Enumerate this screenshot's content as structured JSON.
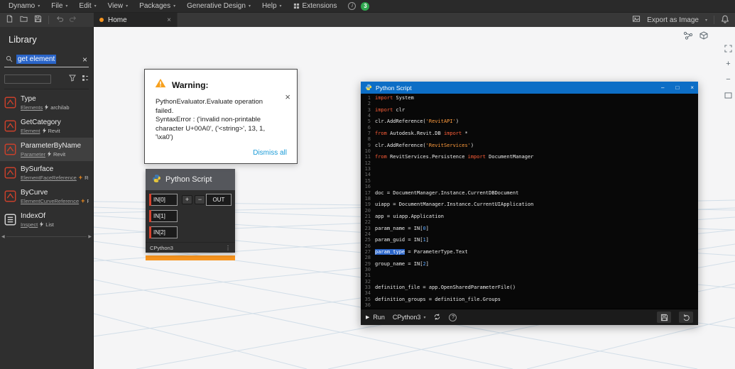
{
  "colors": {
    "accent_blue": "#1a9bd7",
    "titlebar_blue": "#0d6ec6",
    "warning_orange": "#f7a01d",
    "unsaved_orange": "#f7941e",
    "node_error_red": "#d9432e",
    "badge_green": "#2fa84f",
    "selection_blue": "#2a65c9",
    "token_keyword": "#ff5e38",
    "token_string": "#ff9b3d",
    "token_number": "#58a6ff"
  },
  "menubar": {
    "items": [
      {
        "label": "Dynamo",
        "caret": true
      },
      {
        "label": "File",
        "caret": true
      },
      {
        "label": "Edit",
        "caret": true
      },
      {
        "label": "View",
        "caret": true
      },
      {
        "label": "Packages",
        "caret": true
      },
      {
        "label": "Generative Design",
        "caret": true
      },
      {
        "label": "Help",
        "caret": true
      },
      {
        "label": "Extensions",
        "caret": false,
        "icon": "extensions-icon"
      }
    ],
    "notification_count": "3"
  },
  "tabbar": {
    "tab_label": "Home",
    "export_label": "Export as Image"
  },
  "library": {
    "title": "Library",
    "search_value": "get element",
    "items": [
      {
        "title": "Type",
        "category": "Elements",
        "source": "archilab",
        "kind": "action",
        "icon_color": "#c8402b",
        "icon_shape": "box",
        "selected": false
      },
      {
        "title": "GetCategory",
        "category": "Element",
        "source": "Revit",
        "kind": "action",
        "icon_color": "#c8402b",
        "icon_shape": "box",
        "selected": false
      },
      {
        "title": "ParameterByName",
        "category": "Parameter",
        "source": "Revit",
        "kind": "action",
        "icon_color": "#c8402b",
        "icon_shape": "box",
        "selected": true
      },
      {
        "title": "BySurface",
        "category": "ElementFaceReference",
        "source": "Revit",
        "kind": "create",
        "icon_color": "#c8402b",
        "icon_shape": "box",
        "selected": false
      },
      {
        "title": "ByCurve",
        "category": "ElementCurveReference",
        "source": "Revit",
        "kind": "create",
        "icon_color": "#c8402b",
        "icon_shape": "box",
        "selected": false
      },
      {
        "title": "IndexOf",
        "category": "Inspect",
        "source": "List",
        "kind": "action",
        "icon_color": "#d2d2d2",
        "icon_shape": "list",
        "selected": false
      }
    ]
  },
  "warning_popup": {
    "title": "Warning:",
    "message_lines": [
      "PythonEvaluator.Evaluate operation failed.",
      "SyntaxError : ('invalid non-printable",
      "character U+00A0', ('<string>', 13, 1,",
      "'\\xa0')"
    ],
    "dismiss_label": "Dismiss all"
  },
  "python_node": {
    "title": "Python Script",
    "inputs": [
      "IN[0]",
      "IN[1]",
      "IN[2]"
    ],
    "output_label": "OUT",
    "engine_label": "CPython3"
  },
  "editor": {
    "window_title": "Python Script",
    "run_label": "Run",
    "engine_label": "CPython3",
    "code": [
      {
        "n": 1,
        "seg": [
          [
            "k",
            "import"
          ],
          [
            "p",
            " System"
          ]
        ]
      },
      {
        "n": 2,
        "seg": []
      },
      {
        "n": 3,
        "seg": [
          [
            "k",
            "import"
          ],
          [
            "p",
            " clr"
          ]
        ]
      },
      {
        "n": 4,
        "seg": []
      },
      {
        "n": 5,
        "seg": [
          [
            "p",
            "clr.AddReference("
          ],
          [
            "s",
            "'RevitAPI'"
          ],
          [
            "p",
            ")"
          ]
        ]
      },
      {
        "n": 6,
        "seg": []
      },
      {
        "n": 7,
        "seg": [
          [
            "k",
            "from"
          ],
          [
            "p",
            " Autodesk.Revit.DB "
          ],
          [
            "k",
            "import"
          ],
          [
            "p",
            " *"
          ]
        ]
      },
      {
        "n": 8,
        "seg": []
      },
      {
        "n": 9,
        "seg": [
          [
            "p",
            "clr.AddReference("
          ],
          [
            "s",
            "'RevitServices'"
          ],
          [
            "p",
            ")"
          ]
        ]
      },
      {
        "n": 10,
        "seg": []
      },
      {
        "n": 11,
        "seg": [
          [
            "k",
            "from"
          ],
          [
            "p",
            " RevitServices.Persistence "
          ],
          [
            "k",
            "import"
          ],
          [
            "p",
            " DocumentManager"
          ]
        ]
      },
      {
        "n": 12,
        "seg": []
      },
      {
        "n": 13,
        "seg": []
      },
      {
        "n": 14,
        "seg": []
      },
      {
        "n": 15,
        "seg": []
      },
      {
        "n": 16,
        "seg": []
      },
      {
        "n": 17,
        "seg": [
          [
            "p",
            "doc = DocumentManager.Instance.CurrentDBDocument"
          ]
        ]
      },
      {
        "n": 18,
        "seg": []
      },
      {
        "n": 19,
        "seg": [
          [
            "p",
            "uiapp = DocumentManager.Instance.CurrentUIApplication"
          ]
        ]
      },
      {
        "n": 20,
        "seg": []
      },
      {
        "n": 21,
        "seg": [
          [
            "p",
            "app = uiapp.Application"
          ]
        ]
      },
      {
        "n": 22,
        "seg": []
      },
      {
        "n": 23,
        "seg": [
          [
            "p",
            "param_name = IN["
          ],
          [
            "n",
            "0"
          ],
          [
            "p",
            "]"
          ]
        ]
      },
      {
        "n": 24,
        "seg": []
      },
      {
        "n": 25,
        "seg": [
          [
            "p",
            "param_guid = IN["
          ],
          [
            "n",
            "1"
          ],
          [
            "p",
            "]"
          ]
        ]
      },
      {
        "n": 26,
        "seg": []
      },
      {
        "n": 27,
        "seg": [
          [
            "h",
            "param_type"
          ],
          [
            "p",
            " = ParameterType.Text"
          ]
        ]
      },
      {
        "n": 28,
        "seg": []
      },
      {
        "n": 29,
        "seg": [
          [
            "p",
            "group_name = IN["
          ],
          [
            "n",
            "2"
          ],
          [
            "p",
            "]"
          ]
        ]
      },
      {
        "n": 30,
        "seg": []
      },
      {
        "n": 31,
        "seg": []
      },
      {
        "n": 32,
        "seg": []
      },
      {
        "n": 33,
        "seg": [
          [
            "p",
            "definition_file = app.OpenSharedParameterFile()"
          ]
        ]
      },
      {
        "n": 34,
        "seg": []
      },
      {
        "n": 35,
        "seg": [
          [
            "p",
            "definition_groups = definition_file.Groups"
          ]
        ]
      },
      {
        "n": 36,
        "seg": []
      }
    ]
  }
}
